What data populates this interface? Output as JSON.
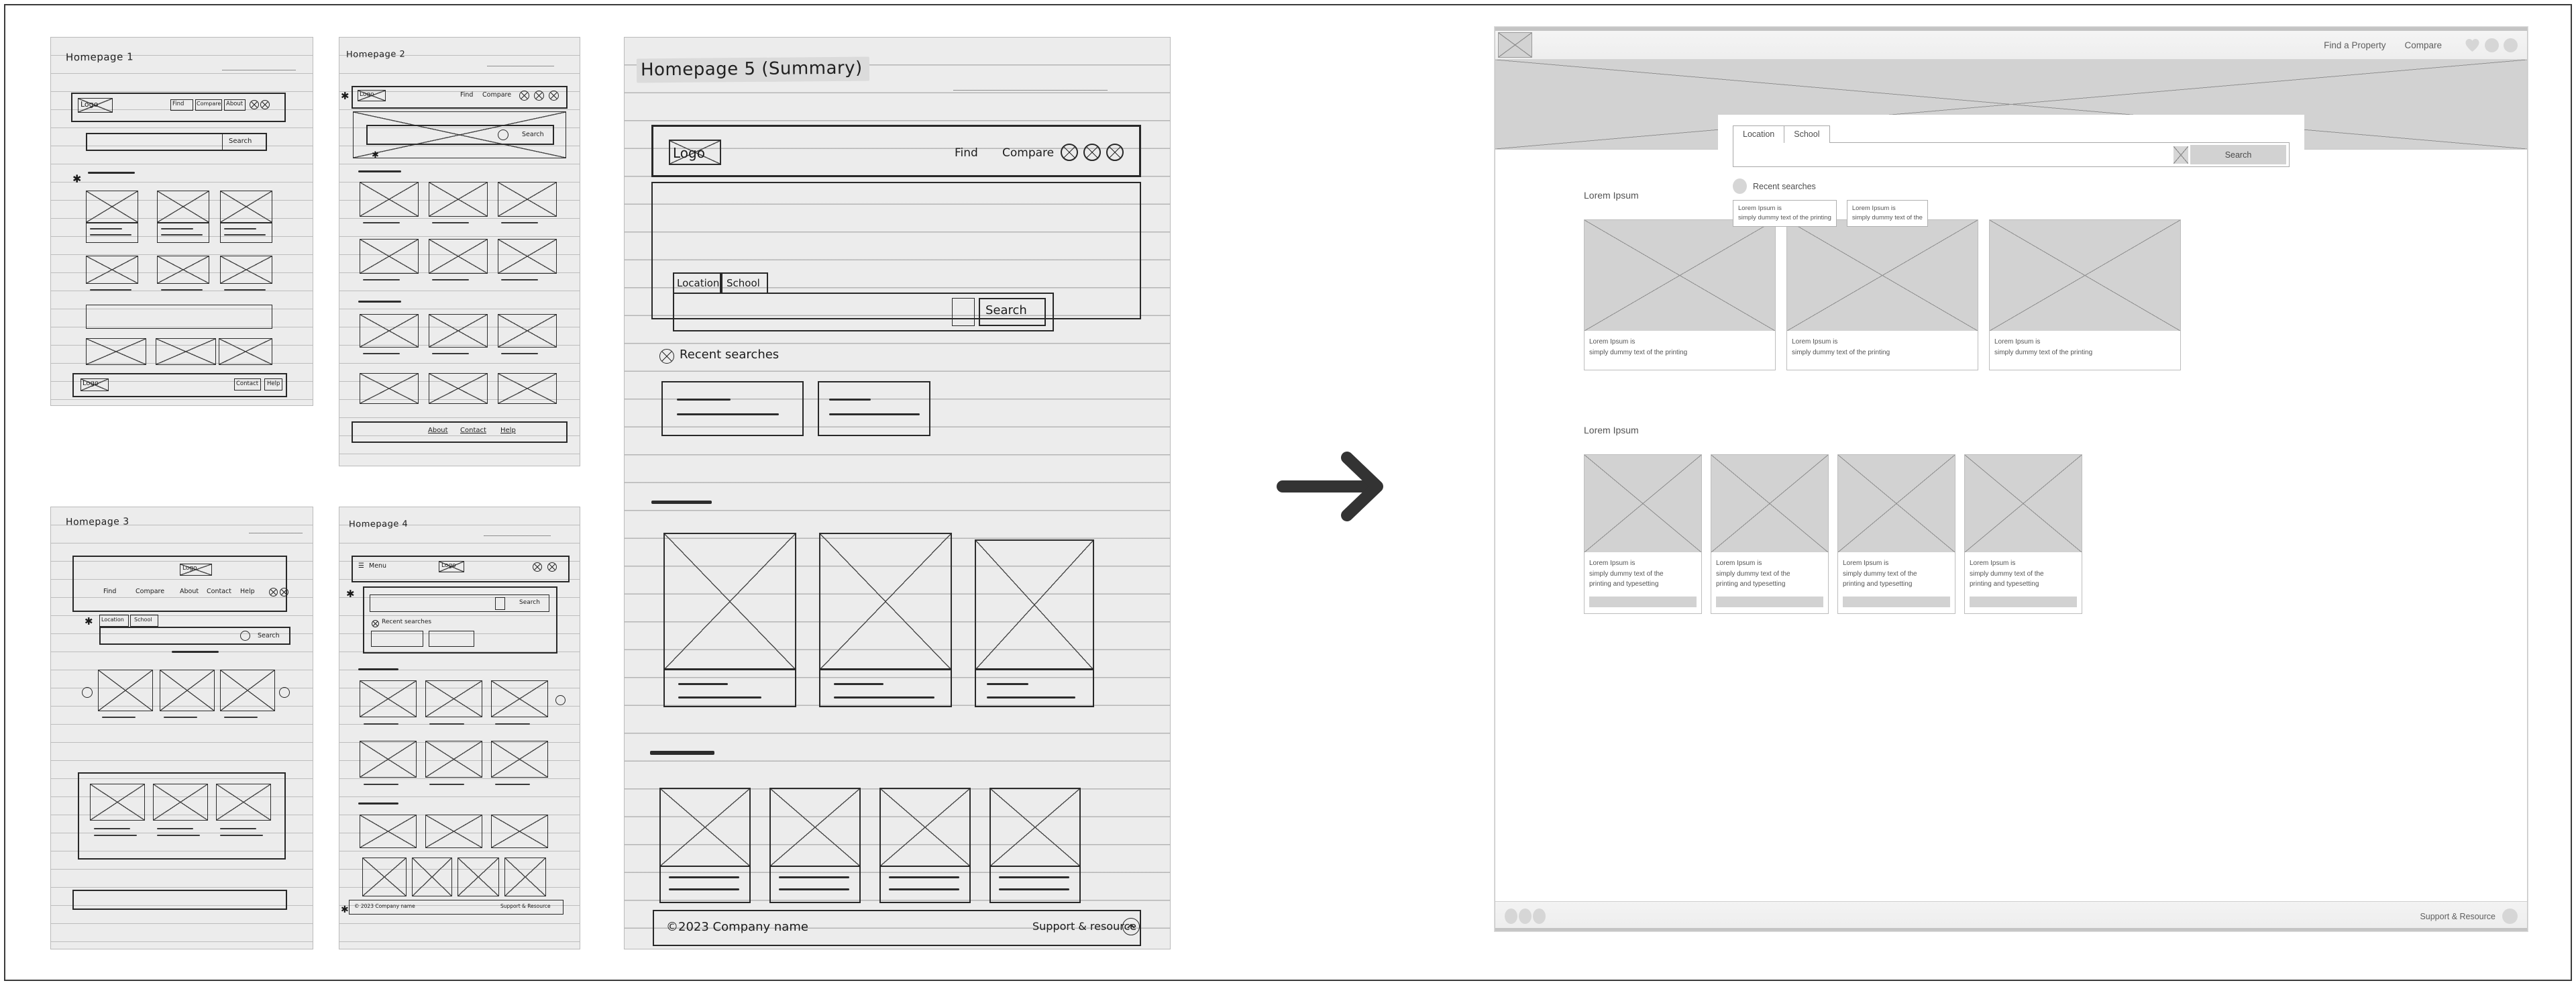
{
  "arrow": {
    "icon": "arrow-right-icon",
    "color": "#333333"
  },
  "sketches": [
    {
      "id": "homepage-1",
      "title": "Homepage 1",
      "logo": "Logo",
      "nav": [
        "Find",
        "Compare",
        "About"
      ],
      "search_button": "Search",
      "footer_logo": "Logo",
      "footer_links": [
        "Contact",
        "Help"
      ],
      "icons": [
        "star-circle-icon",
        "x-circle-icon"
      ]
    },
    {
      "id": "homepage-2",
      "title": "Homepage 2",
      "logo": "Logo",
      "nav": [
        "Find",
        "Compare"
      ],
      "search_button": "Search",
      "footer_links": [
        "About",
        "Contact",
        "Help"
      ],
      "icons": [
        "star-circle-icon",
        "bell-circle-icon",
        "x-circle-icon"
      ]
    },
    {
      "id": "homepage-3",
      "title": "Homepage 3",
      "logo": "Logo",
      "nav": [
        "Find",
        "Compare",
        "About",
        "Contact",
        "Help"
      ],
      "tabs": [
        "Location",
        "School"
      ],
      "search_button": "Search",
      "icons": [
        "star-circle-icon",
        "x-circle-icon"
      ]
    },
    {
      "id": "homepage-4",
      "title": "Homepage 4",
      "menu_label": "Menu",
      "logo": "Logo",
      "search_button": "Search",
      "recent_label": "Recent searches",
      "footer_copyright": "© 2023 Company name",
      "footer_support": "Support & Resource",
      "icons": [
        "star-circle-icon",
        "x-circle-icon",
        "hamburger-icon"
      ]
    },
    {
      "id": "homepage-5",
      "title": "Homepage 5  (Summary)",
      "highlighted": true,
      "logo": "Logo",
      "nav": [
        "Find",
        "Compare"
      ],
      "icons": [
        "star-circle-icon",
        "bell-circle-icon",
        "x-circle-icon"
      ],
      "tabs": [
        "Location",
        "School"
      ],
      "filter_icon": "filter-sliders-icon",
      "search_button": "Search",
      "recent_label": "Recent  searches",
      "recent_count": 2,
      "cards_row1": 3,
      "cards_row2": 4,
      "footer_copyright": "©2023 Company name",
      "footer_support": "Support & resource",
      "footer_scrolltop_icon": "chevron-up-circle-icon"
    }
  ],
  "mockup": {
    "header": {
      "logo_alt": "Logo",
      "nav": [
        {
          "label": "Find a Property"
        },
        {
          "label": "Compare"
        }
      ],
      "icons": [
        {
          "name": "heart-icon"
        },
        {
          "name": "bell-circle-icon"
        },
        {
          "name": "user-circle-icon"
        }
      ]
    },
    "search_panel": {
      "tabs": [
        {
          "label": "Location",
          "active": true
        },
        {
          "label": "School",
          "active": false
        }
      ],
      "input_value": "",
      "input_placeholder": "",
      "clear_icon": "clear-x-icon",
      "search_button": "Search",
      "recent": {
        "icon": "recent-circle-icon",
        "label": "Recent   searches",
        "chips": [
          {
            "line1": "Lorem Ipsum is",
            "line2": "simply dummy text of the printing"
          },
          {
            "line1": "Lorem Ipsum is",
            "line2": "simply dummy text of the"
          }
        ]
      }
    },
    "sections": [
      {
        "title": "Lorem Ipsum",
        "layout": "row-3",
        "cards": [
          {
            "image_alt": "placeholder-image",
            "line1": "Lorem Ipsum is",
            "line2": "simply dummy text of the printing"
          },
          {
            "image_alt": "placeholder-image",
            "line1": "Lorem Ipsum is",
            "line2": "simply dummy text of the printing"
          },
          {
            "image_alt": "placeholder-image",
            "line1": "Lorem Ipsum is",
            "line2": "simply dummy text of the printing"
          }
        ]
      },
      {
        "title": "Lorem Ipsum",
        "layout": "row-4",
        "cards": [
          {
            "image_alt": "placeholder-image",
            "line1": "Lorem Ipsum is",
            "line2": "simply dummy text of the",
            "line3": "printing and typesetting",
            "has_bar": true
          },
          {
            "image_alt": "placeholder-image",
            "line1": "Lorem Ipsum is",
            "line2": "simply dummy text of the",
            "line3": "printing and typesetting",
            "has_bar": true
          },
          {
            "image_alt": "placeholder-image",
            "line1": "Lorem Ipsum is",
            "line2": "simply dummy text of the",
            "line3": "printing and typesetting",
            "has_bar": true
          },
          {
            "image_alt": "placeholder-image",
            "line1": "Lorem Ipsum is",
            "line2": "simply dummy text of the",
            "line3": "printing and typesetting",
            "has_bar": true
          }
        ]
      }
    ],
    "footer": {
      "icons": [
        "social-circle-icon",
        "social-circle-icon",
        "social-circle-icon"
      ],
      "support_label": "Support & Resource",
      "support_icon": "support-circle-icon"
    }
  },
  "colors": {
    "wire_fill": "#d2d2d2",
    "wire_stroke": "#8d8d8d",
    "panel_bg": "#ffffff",
    "chrome": "#f2f2f2",
    "text": "#555555",
    "highlight": "#e6d9a4",
    "arrow": "#333333"
  }
}
